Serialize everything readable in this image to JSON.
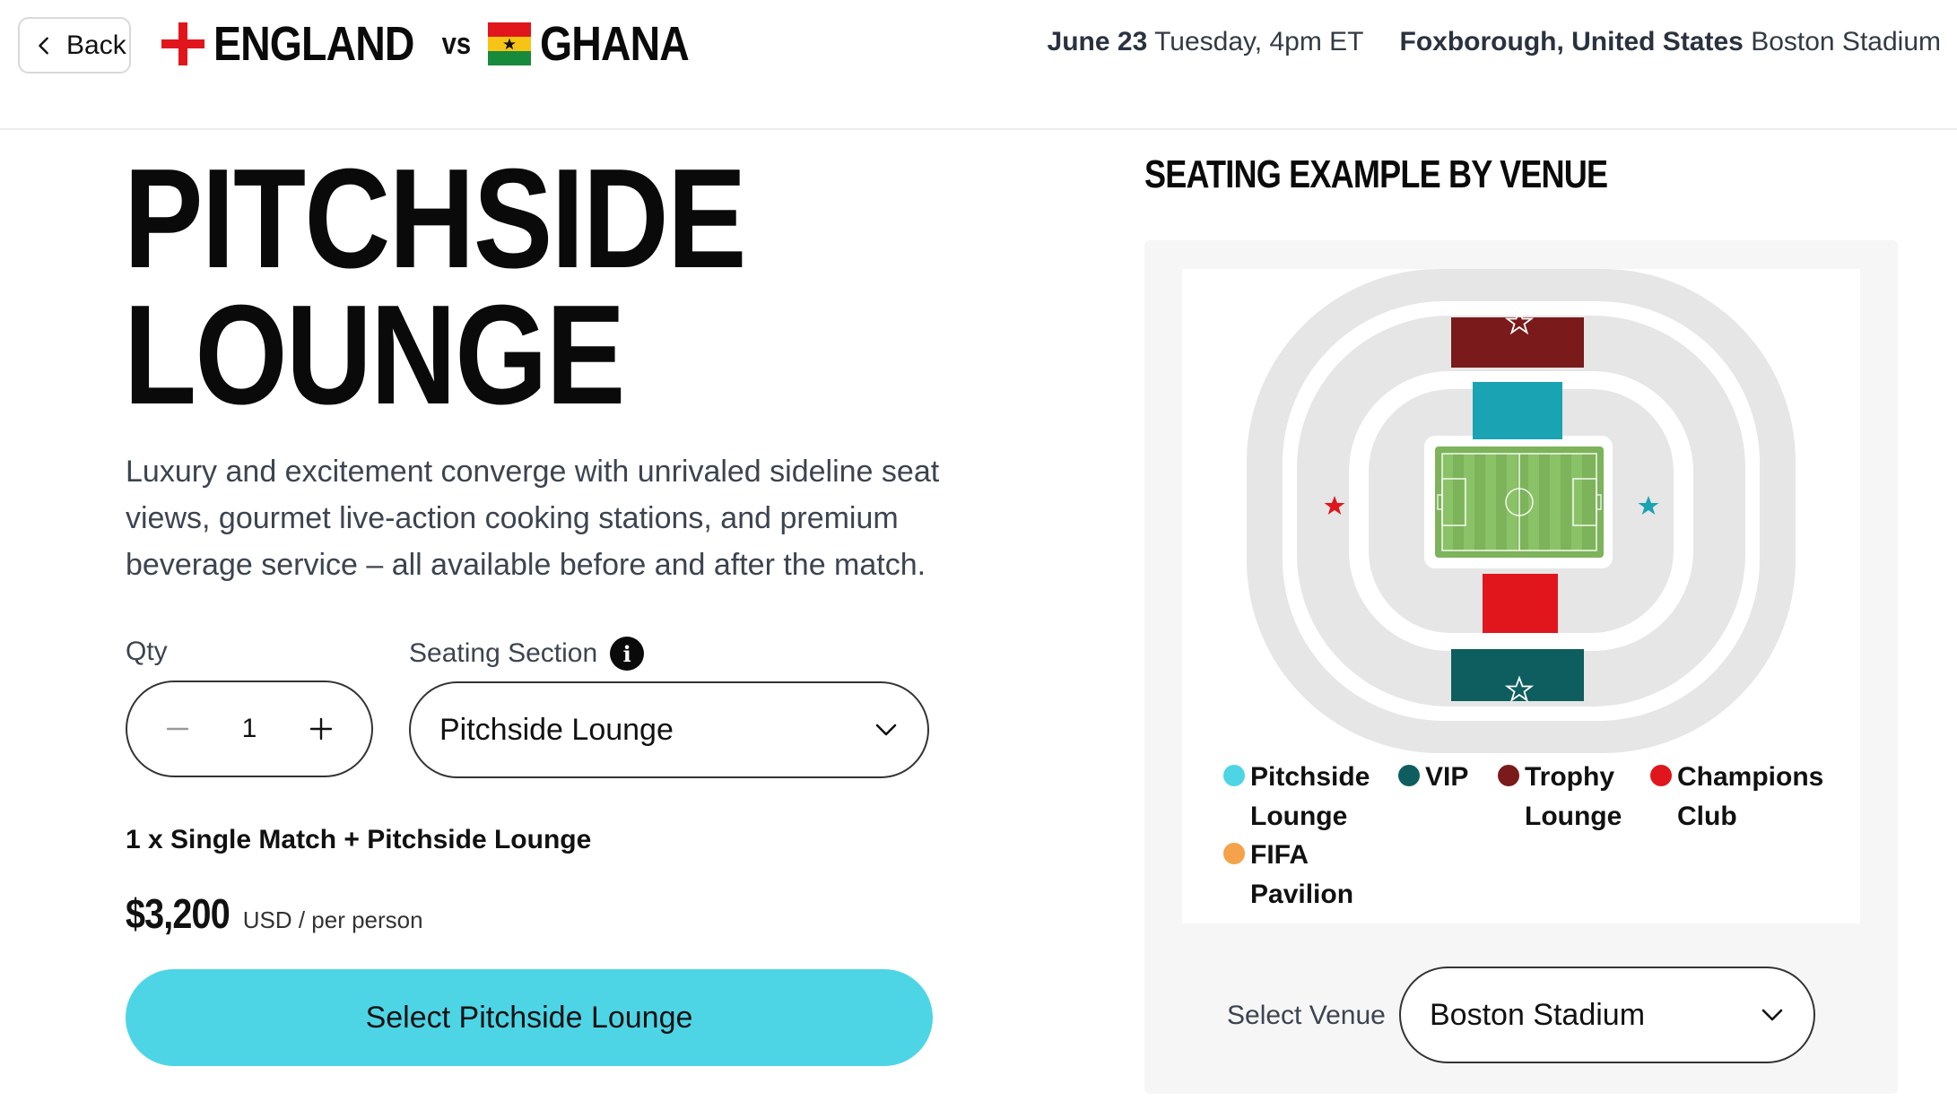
{
  "header": {
    "back_label": "Back",
    "team_home": "ENGLAND",
    "vs_label": "vs",
    "team_away": "GHANA",
    "date_bold": "June 23",
    "date_rest": "Tuesday, 4pm ET",
    "location_bold": "Foxborough, United States",
    "location_rest": "Boston Stadium"
  },
  "product": {
    "title_line1": "PITCHSIDE",
    "title_line2": "LOUNGE",
    "description": "Luxury and excitement converge with unrivaled sideline seat views, gourmet live-action cooking stations, and premium beverage service – all available before and after the match.",
    "qty_label": "Qty",
    "qty_value": "1",
    "section_label": "Seating Section",
    "section_selected": "Pitchside Lounge",
    "summary": "1 x Single Match + Pitchside Lounge",
    "price": "$3,200",
    "price_unit": "USD / per person",
    "cta_label": "Select Pitchside Lounge"
  },
  "map": {
    "heading": "SEATING EXAMPLE BY VENUE",
    "legend": [
      {
        "label": "Pitchside",
        "label2": "Lounge",
        "color": "#4dd5e6"
      },
      {
        "label": "VIP",
        "label2": "",
        "color": "#0f5e5f"
      },
      {
        "label": "Trophy",
        "label2": "Lounge",
        "color": "#7a1a1a"
      },
      {
        "label": "Champions",
        "label2": "Club",
        "color": "#e0161c"
      },
      {
        "label": "FIFA",
        "label2": "Pavilion",
        "color": "#f5a24a"
      }
    ],
    "venue_label": "Select Venue",
    "venue_selected": "Boston Stadium"
  },
  "icons": {
    "back": "chevron-left-icon",
    "info": "info-icon",
    "minus": "minus-icon",
    "plus": "plus-icon",
    "dropdown": "chevron-down-icon"
  }
}
